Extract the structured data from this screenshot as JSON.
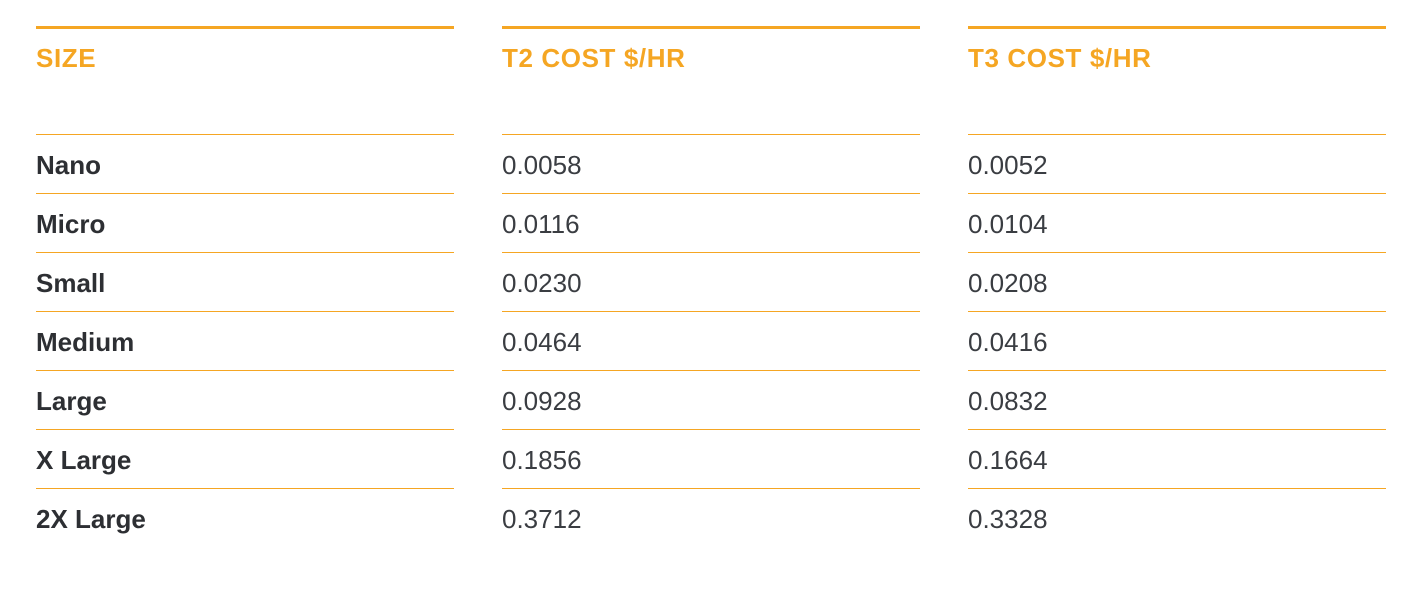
{
  "chart_data": {
    "type": "table",
    "title": "",
    "columns": [
      "SIZE",
      "T2 COST $/HR",
      "T3 COST $/HR"
    ],
    "categories": [
      "Nano",
      "Micro",
      "Small",
      "Medium",
      "Large",
      "X Large",
      "2X Large"
    ],
    "series": [
      {
        "name": "T2 COST $/HR",
        "values": [
          0.0058,
          0.0116,
          0.023,
          0.0464,
          0.0928,
          0.1856,
          0.3712
        ]
      },
      {
        "name": "T3 COST $/HR",
        "values": [
          0.0052,
          0.0104,
          0.0208,
          0.0416,
          0.0832,
          0.1664,
          0.3328
        ]
      }
    ]
  },
  "table": {
    "headers": {
      "size": "SIZE",
      "t2": "T2 COST $/HR",
      "t3": "T3 COST $/HR"
    },
    "rows": [
      {
        "size": "Nano",
        "t2": "0.0058",
        "t3": "0.0052"
      },
      {
        "size": "Micro",
        "t2": "0.0116",
        "t3": "0.0104"
      },
      {
        "size": "Small",
        "t2": "0.0230",
        "t3": "0.0208"
      },
      {
        "size": "Medium",
        "t2": "0.0464",
        "t3": "0.0416"
      },
      {
        "size": "Large",
        "t2": "0.0928",
        "t3": "0.0832"
      },
      {
        "size": "X Large",
        "t2": "0.1856",
        "t3": "0.1664"
      },
      {
        "size": "2X Large",
        "t2": "0.3712",
        "t3": "0.3328"
      }
    ]
  },
  "colors": {
    "accent": "#f5a623",
    "text": "#2d2f33"
  }
}
